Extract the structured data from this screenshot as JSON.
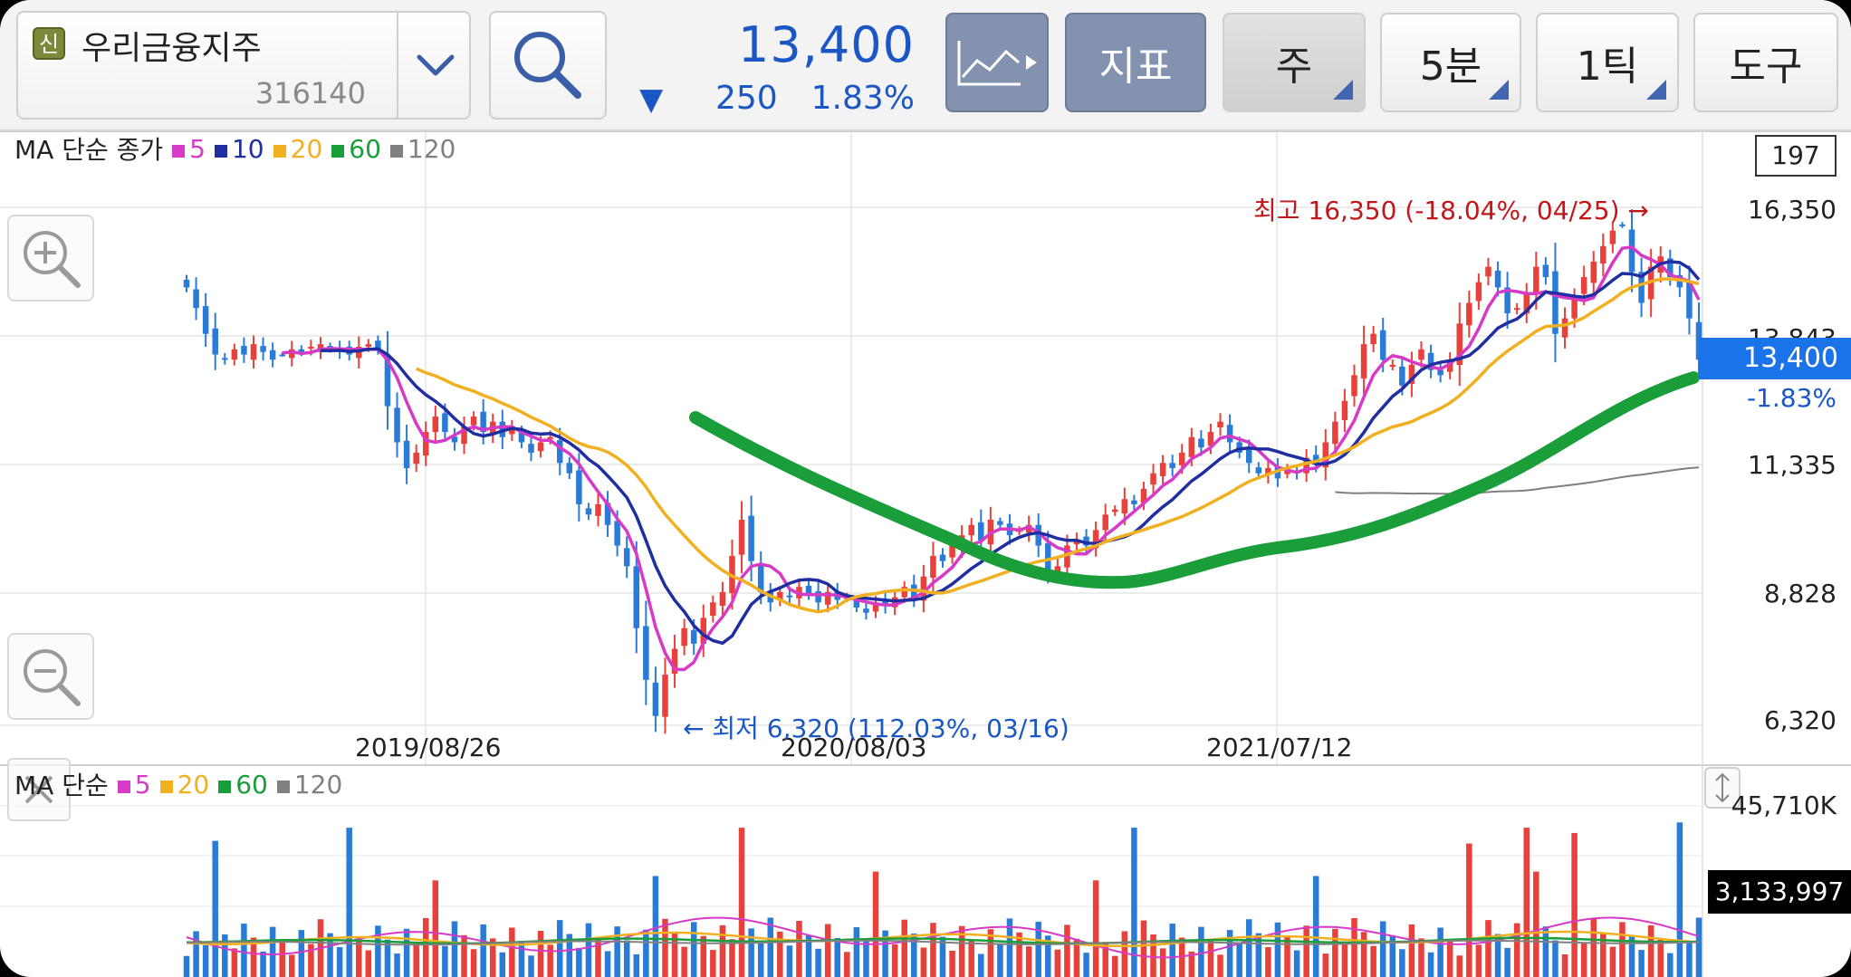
{
  "stock": {
    "badge": "신",
    "name": "우리금융지주",
    "code": "316140",
    "price": "13,400",
    "change_arrow": "▼",
    "change": "250",
    "change_pct": "1.83%"
  },
  "toolbar": {
    "indicator_label": "지표",
    "period_label": "주",
    "interval_label": "5분",
    "tick_label": "1틱",
    "tools_label": "도구"
  },
  "price_panel": {
    "legend_title": "MA 단순 종가",
    "legend": [
      {
        "label": "5",
        "color": "#d63ac7"
      },
      {
        "label": "10",
        "color": "#1f2ea0"
      },
      {
        "label": "20",
        "color": "#f0b020"
      },
      {
        "label": "60",
        "color": "#1a9e3a"
      },
      {
        "label": "120",
        "color": "#808080"
      }
    ],
    "count": "197",
    "y_labels": [
      "16,350",
      "13,843",
      "11,335",
      "8,828",
      "6,320"
    ],
    "x_labels": [
      "2019/08/26",
      "2020/08/03",
      "2021/07/12"
    ],
    "current_price_tag": "13,400",
    "current_change_pct": "-1.83%",
    "high_label": "최고 16,350 (-18.04%, 04/25) →",
    "low_label": "← 최저 6,320 (112.03%, 03/16)"
  },
  "volume_panel": {
    "legend_title": "MA 단순",
    "legend": [
      {
        "label": "5",
        "color": "#d63ac7"
      },
      {
        "label": "20",
        "color": "#f0b020"
      },
      {
        "label": "60",
        "color": "#1a9e3a"
      },
      {
        "label": "120",
        "color": "#808080"
      }
    ],
    "max_label": "45,710K",
    "current_volume_tag": "3,133,997"
  },
  "colors": {
    "up": "#e8403a",
    "down": "#2a7bd8",
    "accent": "#1a73e8",
    "drawn_trendline": "#1a9e3a"
  },
  "chart_data": {
    "type": "candlestick",
    "ylim": [
      6320,
      16350
    ],
    "series_close": [
      14800,
      14400,
      13900,
      13500,
      13400,
      13600,
      13500,
      13700,
      13550,
      13400,
      13500,
      13600,
      13550,
      13650,
      13700,
      13600,
      13550,
      13500,
      13650,
      13700,
      13600,
      12500,
      11800,
      11300,
      11600,
      12000,
      12300,
      12000,
      11800,
      12100,
      12300,
      12000,
      12200,
      11900,
      12100,
      11800,
      11600,
      11800,
      11900,
      11400,
      11200,
      10600,
      10400,
      10600,
      10200,
      9800,
      9400,
      8200,
      7200,
      6500,
      7300,
      7800,
      8200,
      7900,
      8400,
      8700,
      8900,
      9600,
      10300,
      9500,
      8900,
      8700,
      8900,
      8800,
      9000,
      8850,
      8700,
      8900,
      8750,
      8800,
      8600,
      8500,
      8700,
      8650,
      8800,
      9000,
      8800,
      9200,
      9600,
      9500,
      9800,
      10000,
      10200,
      9900,
      10300,
      10200,
      10000,
      10100,
      10200,
      9800,
      9300,
      9400,
      9800,
      9900,
      9800,
      10100,
      10400,
      10500,
      10700,
      10600,
      10900,
      11200,
      11400,
      11300,
      11600,
      11900,
      11700,
      12000,
      12200,
      11800,
      11600,
      11400,
      11200,
      11300,
      11100,
      11300,
      11200,
      11500,
      11400,
      11800,
      12200,
      12600,
      13100,
      13700,
      13900,
      13400,
      13300,
      12900,
      13300,
      13600,
      13200,
      13100,
      13400,
      14100,
      14500,
      14900,
      15200,
      14800,
      14300,
      14400,
      14700,
      15200,
      15000,
      13900,
      14200,
      14600,
      15000,
      15300,
      15600,
      15900,
      16000,
      15100,
      14500,
      15200,
      15400,
      15000,
      14800,
      14200,
      13400
    ],
    "ma60_visible": true,
    "ma120_visible": true
  }
}
